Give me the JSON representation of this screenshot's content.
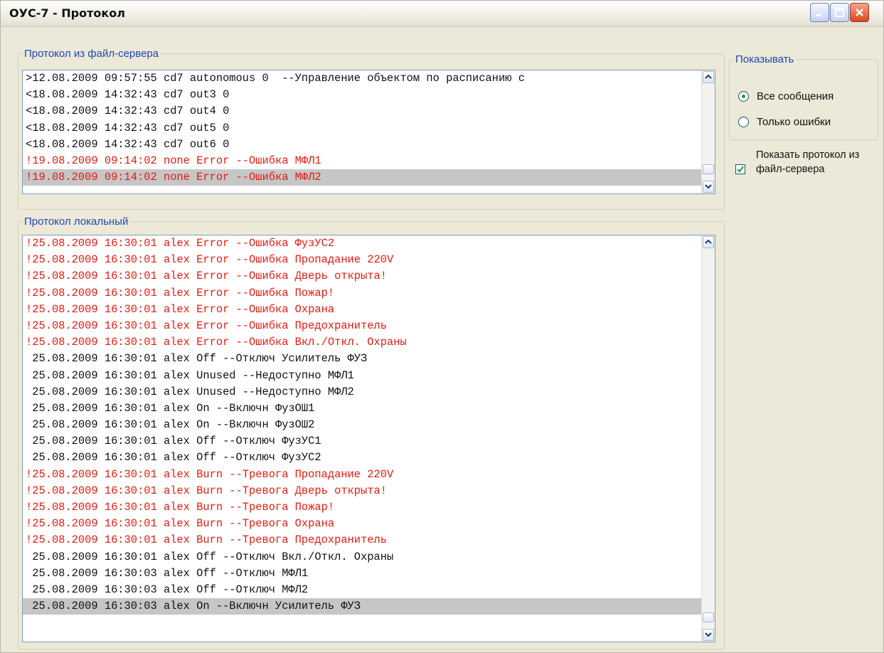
{
  "window": {
    "title": "ОУС-7 - Протокол"
  },
  "server_group": {
    "label": "Протокол из файл-сервера",
    "lines": [
      {
        "text": ">12.08.2009 09:57:55 cd7 autonomous 0  --Управление объектом по расписанию с",
        "error": false,
        "selected": false
      },
      {
        "text": "<18.08.2009 14:32:43 cd7 out3 0",
        "error": false,
        "selected": false
      },
      {
        "text": "<18.08.2009 14:32:43 cd7 out4 0",
        "error": false,
        "selected": false
      },
      {
        "text": "<18.08.2009 14:32:43 cd7 out5 0",
        "error": false,
        "selected": false
      },
      {
        "text": "<18.08.2009 14:32:43 cd7 out6 0",
        "error": false,
        "selected": false
      },
      {
        "text": "!19.08.2009 09:14:02 none Error --Ошибка МФЛ1",
        "error": true,
        "selected": false
      },
      {
        "text": "!19.08.2009 09:14:02 none Error --Ошибка МФЛ2",
        "error": true,
        "selected": true
      }
    ]
  },
  "local_group": {
    "label": "Протокол локальный",
    "lines": [
      {
        "text": "!25.08.2009 16:30:01 alex Error --Ошибка ФузУС2",
        "error": true,
        "selected": false
      },
      {
        "text": "!25.08.2009 16:30:01 alex Error --Ошибка Пропадание 220V",
        "error": true,
        "selected": false
      },
      {
        "text": "!25.08.2009 16:30:01 alex Error --Ошибка Дверь открыта!",
        "error": true,
        "selected": false
      },
      {
        "text": "!25.08.2009 16:30:01 alex Error --Ошибка Пожар!",
        "error": true,
        "selected": false
      },
      {
        "text": "!25.08.2009 16:30:01 alex Error --Ошибка Охрана",
        "error": true,
        "selected": false
      },
      {
        "text": "!25.08.2009 16:30:01 alex Error --Ошибка Предохранитель",
        "error": true,
        "selected": false
      },
      {
        "text": "!25.08.2009 16:30:01 alex Error --Ошибка Вкл./Откл. Охраны",
        "error": true,
        "selected": false
      },
      {
        "text": " 25.08.2009 16:30:01 alex Off --Отключ Усилитель ФУЗ",
        "error": false,
        "selected": false
      },
      {
        "text": " 25.08.2009 16:30:01 alex Unused --Недоступно МФЛ1",
        "error": false,
        "selected": false
      },
      {
        "text": " 25.08.2009 16:30:01 alex Unused --Недоступно МФЛ2",
        "error": false,
        "selected": false
      },
      {
        "text": " 25.08.2009 16:30:01 alex On --Включн ФузОШ1",
        "error": false,
        "selected": false
      },
      {
        "text": " 25.08.2009 16:30:01 alex On --Включн ФузОШ2",
        "error": false,
        "selected": false
      },
      {
        "text": " 25.08.2009 16:30:01 alex Off --Отключ ФузУС1",
        "error": false,
        "selected": false
      },
      {
        "text": " 25.08.2009 16:30:01 alex Off --Отключ ФузУС2",
        "error": false,
        "selected": false
      },
      {
        "text": "!25.08.2009 16:30:01 alex Burn --Тревога Пропадание 220V",
        "error": true,
        "selected": false
      },
      {
        "text": "!25.08.2009 16:30:01 alex Burn --Тревога Дверь открыта!",
        "error": true,
        "selected": false
      },
      {
        "text": "!25.08.2009 16:30:01 alex Burn --Тревога Пожар!",
        "error": true,
        "selected": false
      },
      {
        "text": "!25.08.2009 16:30:01 alex Burn --Тревога Охрана",
        "error": true,
        "selected": false
      },
      {
        "text": "!25.08.2009 16:30:01 alex Burn --Тревога Предохранитель",
        "error": true,
        "selected": false
      },
      {
        "text": " 25.08.2009 16:30:01 alex Off --Отключ Вкл./Откл. Охраны",
        "error": false,
        "selected": false
      },
      {
        "text": " 25.08.2009 16:30:03 alex Off --Отключ МФЛ1",
        "error": false,
        "selected": false
      },
      {
        "text": " 25.08.2009 16:30:03 alex Off --Отключ МФЛ2",
        "error": false,
        "selected": false
      },
      {
        "text": " 25.08.2009 16:30:03 alex On --Включн Усилитель ФУЗ",
        "error": false,
        "selected": true
      }
    ]
  },
  "show_group": {
    "label": "Показывать",
    "options": [
      {
        "label": "Все сообщения",
        "checked": true
      },
      {
        "label": "Только ошибки",
        "checked": false
      }
    ]
  },
  "show_server_checkbox": {
    "label": "Показать протокол из файл-сервера",
    "checked": true
  },
  "colors": {
    "error_text": "#e8190f",
    "group_label": "#1f46b8",
    "selection": "#c6c6c6"
  }
}
